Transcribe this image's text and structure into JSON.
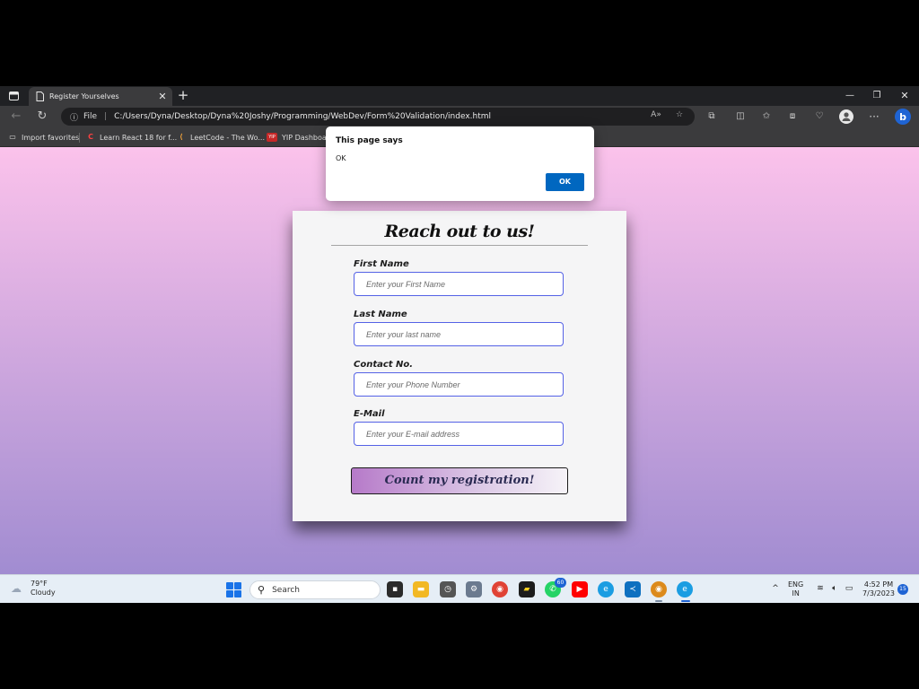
{
  "browser": {
    "tab_title": "Register Yourselves",
    "url_scheme": "File",
    "url": "C:/Users/Dyna/Desktop/Dyna%20Joshy/Programming/WebDev/Form%20Validation/index.html",
    "bookmarks": [
      {
        "label": "Import favorites",
        "icon": "folder-icon"
      },
      {
        "label": "Learn React 18 for f...",
        "icon": "codecademy-icon"
      },
      {
        "label": "LeetCode - The Wo...",
        "icon": "leetcode-icon"
      },
      {
        "label": "YIP Dashboard",
        "icon": "yip-icon"
      }
    ]
  },
  "dialog": {
    "title": "This page says",
    "message": "OK",
    "ok_label": "OK"
  },
  "form": {
    "title": "Reach out to us!",
    "fields": [
      {
        "label": "First Name",
        "placeholder": "Enter your First Name"
      },
      {
        "label": "Last Name",
        "placeholder": "Enter your last name"
      },
      {
        "label": "Contact No.",
        "placeholder": "Enter your Phone Number"
      },
      {
        "label": "E-Mail",
        "placeholder": "Enter your E-mail address"
      }
    ],
    "submit_label": "Count my registration!"
  },
  "taskbar": {
    "weather_temp": "79°F",
    "weather_desc": "Cloudy",
    "search_label": "Search",
    "whatsapp_badge": "60",
    "lang_line1": "ENG",
    "lang_line2": "IN",
    "time": "4:52 PM",
    "date": "7/3/2023",
    "notifications": "15"
  },
  "colors": {
    "page_gradient_top": "#fbc2eb",
    "page_gradient_bottom": "#a18cd1",
    "input_border": "#5562e6",
    "dialog_ok": "#0067c0"
  }
}
